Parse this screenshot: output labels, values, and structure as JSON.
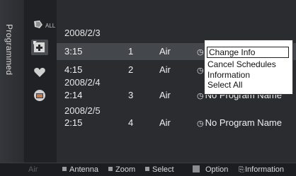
{
  "sidebar": {
    "title": "Programmed"
  },
  "icons": {
    "all_label": "ALL"
  },
  "dates": [
    "2008/2/3",
    "2008/2/4",
    "2008/2/5"
  ],
  "rows": [
    {
      "time": "3:15",
      "channel": "1",
      "source": "Air",
      "program": ""
    },
    {
      "time": "4:15",
      "channel": "2",
      "source": "Air",
      "program": ""
    },
    {
      "time": "2:14",
      "channel": "3",
      "source": "Air",
      "program": "No Program Name"
    },
    {
      "time": "2:15",
      "channel": "4",
      "source": "Air",
      "program": "No Program Name"
    }
  ],
  "context_menu": {
    "items": [
      "Change Info",
      "Cancel Schedules",
      "Information",
      "Select All"
    ],
    "selected": "Change Info"
  },
  "bottom_bar": {
    "air": "Air",
    "antenna": "Antenna",
    "zoom": "Zoom",
    "select": "Select",
    "option": "Option",
    "information": "Information"
  }
}
